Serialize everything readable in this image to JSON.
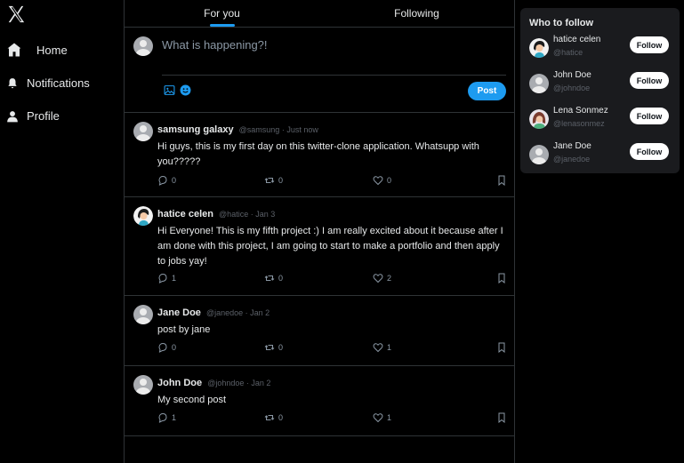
{
  "nav": {
    "items": [
      {
        "label": "Home",
        "icon": "home-icon"
      },
      {
        "label": "Notifications",
        "icon": "bell-icon"
      },
      {
        "label": "Profile",
        "icon": "user-icon"
      }
    ]
  },
  "tabs": [
    {
      "label": "For you",
      "active": true
    },
    {
      "label": "Following",
      "active": false
    }
  ],
  "composer": {
    "placeholder": "What is happening?!",
    "post_label": "Post"
  },
  "posts": [
    {
      "name": "samsung galaxy",
      "handle": "@samsung",
      "time": "Just now",
      "body": "Hi guys, this is my first day on this twitter-clone application. Whatsupp with you?????",
      "replies": "0",
      "reposts": "0",
      "likes": "0"
    },
    {
      "name": "hatice celen",
      "handle": "@hatice",
      "time": "Jan 3",
      "body": "Hi Everyone! This is my fifth project :) I am really excited about it because after I am done with this project, I am going to start to make a portfolio and then apply to jobs yay!",
      "replies": "1",
      "reposts": "0",
      "likes": "2"
    },
    {
      "name": "Jane Doe",
      "handle": "@janedoe",
      "time": "Jan 2",
      "body": "post by jane",
      "replies": "0",
      "reposts": "0",
      "likes": "1"
    },
    {
      "name": "John Doe",
      "handle": "@johndoe",
      "time": "Jan 2",
      "body": "My second post",
      "replies": "1",
      "reposts": "0",
      "likes": "1"
    }
  ],
  "who_to_follow": {
    "title": "Who to follow",
    "follow_label": "Follow",
    "users": [
      {
        "name": "hatice celen",
        "handle": "@hatice"
      },
      {
        "name": "John Doe",
        "handle": "@johndoe"
      },
      {
        "name": "Lena Sonmez",
        "handle": "@lenasonmez"
      },
      {
        "name": "Jane Doe",
        "handle": "@janedoe"
      }
    ]
  },
  "colors": {
    "accent": "#1d9bf0",
    "background": "#000000",
    "border": "#2f3336",
    "card": "#1a1b1e"
  }
}
